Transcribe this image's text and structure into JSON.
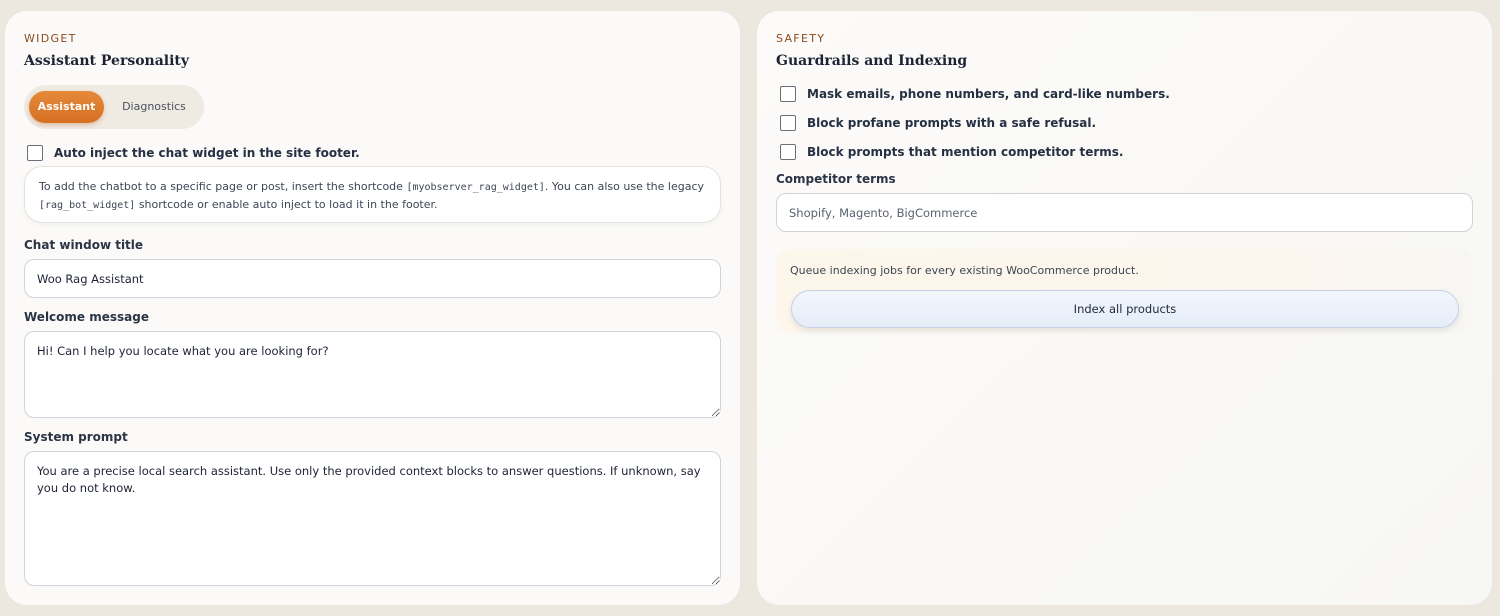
{
  "widget": {
    "eyebrow": "WIDGET",
    "title": "Assistant Personality",
    "tabs": [
      {
        "label": "Assistant",
        "active": true
      },
      {
        "label": "Diagnostics",
        "active": false
      }
    ],
    "auto_inject": {
      "label": "Auto inject the chat widget in the site footer.",
      "checked": false
    },
    "note": {
      "part1": "To add the chatbot to a specific page or post, insert the shortcode ",
      "code1": "[myobserver_rag_widget]",
      "part2": ". You can also use the legacy ",
      "code2": "[rag_bot_widget]",
      "part3": " shortcode or enable auto inject to load it in the footer."
    },
    "chat_title": {
      "label": "Chat window title",
      "value": "Woo Rag Assistant"
    },
    "welcome": {
      "label": "Welcome message",
      "value": "Hi! Can I help you locate what you are looking for?"
    },
    "system_prompt": {
      "label": "System prompt",
      "value": "You are a precise local search assistant. Use only the provided context blocks to answer questions. If unknown, say you do not know."
    }
  },
  "safety": {
    "eyebrow": "SAFETY",
    "title": "Guardrails and Indexing",
    "checks": [
      {
        "label": "Mask emails, phone numbers, and card-like numbers.",
        "checked": false
      },
      {
        "label": "Block profane prompts with a safe refusal.",
        "checked": false
      },
      {
        "label": "Block prompts that mention competitor terms.",
        "checked": false
      }
    ],
    "competitor": {
      "label": "Competitor terms",
      "placeholder": "Shopify, Magento, BigCommerce"
    },
    "queue": {
      "text": "Queue indexing jobs for every existing WooCommerce product.",
      "button": "Index all products"
    }
  },
  "colors": {
    "accent": "#d97a2b",
    "eyebrow": "#8c4a1c",
    "background": "#ece8e0"
  }
}
